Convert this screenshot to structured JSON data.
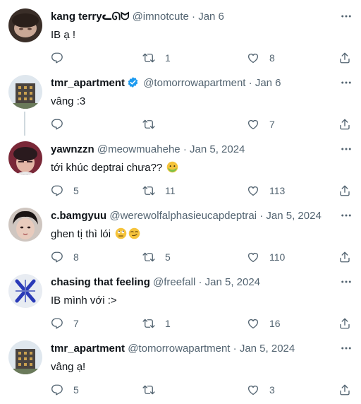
{
  "tweets": [
    {
      "name": "kang terryᓚᘏᗢ",
      "handle": "@imnotcute",
      "date": "Jan 6",
      "text": "IB ạ !",
      "replies": "",
      "retweets": "1",
      "likes": "8"
    },
    {
      "name": "tmr_apartment",
      "handle": "@tomorrowapartment",
      "date": "Jan 6",
      "text": "vâng  :3",
      "replies": "",
      "retweets": "",
      "likes": "7"
    },
    {
      "name": "yawnzzn",
      "handle": "@meowmuahehe",
      "date": "Jan 5, 2024",
      "text": "tới khúc deptrai chưa??",
      "replies": "5",
      "retweets": "11",
      "likes": "113"
    },
    {
      "name": "c.bamgyuu",
      "handle": "@werewolfalphasieucapdeptrai",
      "date": "Jan 5, 2024",
      "text": "ghen tị thì lói",
      "replies": "8",
      "retweets": "5",
      "likes": "110"
    },
    {
      "name": "chasing that feeling",
      "handle": "@freefall",
      "date": "Jan 5, 2024",
      "text": "IB mình với :>",
      "replies": "7",
      "retweets": "1",
      "likes": "16"
    },
    {
      "name": "tmr_apartment",
      "handle": "@tomorrowapartment",
      "date": "Jan 5, 2024",
      "text": "vâng ạ!",
      "replies": "5",
      "retweets": "",
      "likes": "3"
    }
  ],
  "separator": "·",
  "colors": {
    "verified": "#1d9bf0",
    "muted": "#536471",
    "thread_line": "#cfd9de"
  },
  "icons": [
    "more-icon",
    "reply-icon",
    "retweet-icon",
    "like-icon",
    "share-icon",
    "verified-icon"
  ]
}
